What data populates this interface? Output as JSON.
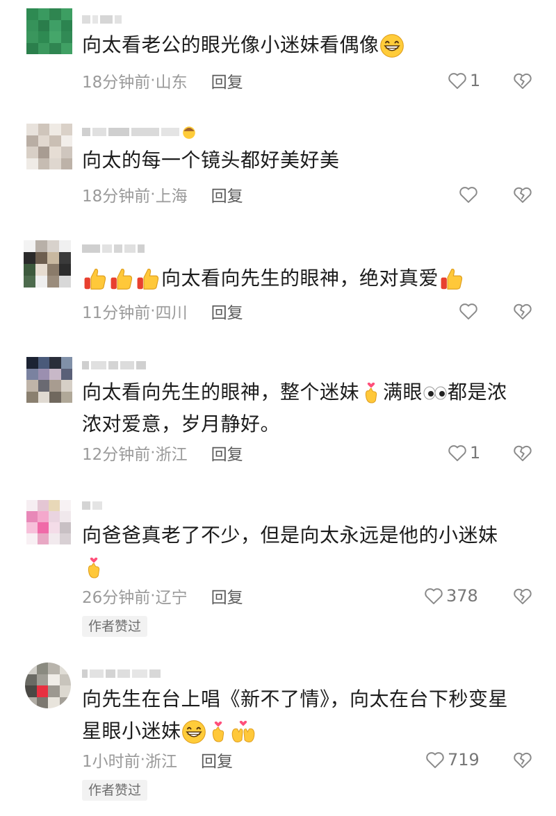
{
  "comments": [
    {
      "text": "向太看老公的眼光像小迷妹看偶像",
      "emojis_after": [
        "grin-emoji"
      ],
      "time": "18分钟前",
      "location": "山东",
      "reply": "回复",
      "likes": "1",
      "author_liked": false
    },
    {
      "text": "向太的每一个镜头都好美好美",
      "emojis_after": [],
      "time": "18分钟前",
      "location": "上海",
      "reply": "回复",
      "likes": "",
      "author_liked": false
    },
    {
      "text_before_emojis": [
        "thumbs-up-emoji",
        "thumbs-up-emoji",
        "thumbs-up-emoji"
      ],
      "text": "向太看向先生的眼神，绝对真爱",
      "emojis_after": [
        "thumbs-up-emoji"
      ],
      "time": "11分钟前",
      "location": "四川",
      "reply": "回复",
      "likes": "",
      "author_liked": false
    },
    {
      "text_line1_a": "向太看向先生的眼神，整个迷妹",
      "text_line1_b": "满眼",
      "text_line1_c": "都是浓",
      "text_line2": "浓对爱意，岁月静好。",
      "time": "12分钟前",
      "location": "浙江",
      "reply": "回复",
      "likes": "1",
      "author_liked": false
    },
    {
      "text": "向爸爸真老了不少，但是向太永远是他的小迷妹",
      "time": "26分钟前",
      "location": "辽宁",
      "reply": "回复",
      "likes": "378",
      "author_liked": true,
      "badge": "作者赞过"
    },
    {
      "text_line1": "向先生在台上唱《新不了情》，向太在台下秒变星",
      "text_line2": "星眼小迷妹",
      "time": "1小时前",
      "location": "浙江",
      "reply": "回复",
      "likes": "719",
      "author_liked": true,
      "badge": "作者赞过"
    }
  ],
  "separator": " · ",
  "colors": {
    "meta": "#9a9a9a",
    "reply": "#5a5a5a",
    "badge_bg": "#f2f2f2"
  }
}
